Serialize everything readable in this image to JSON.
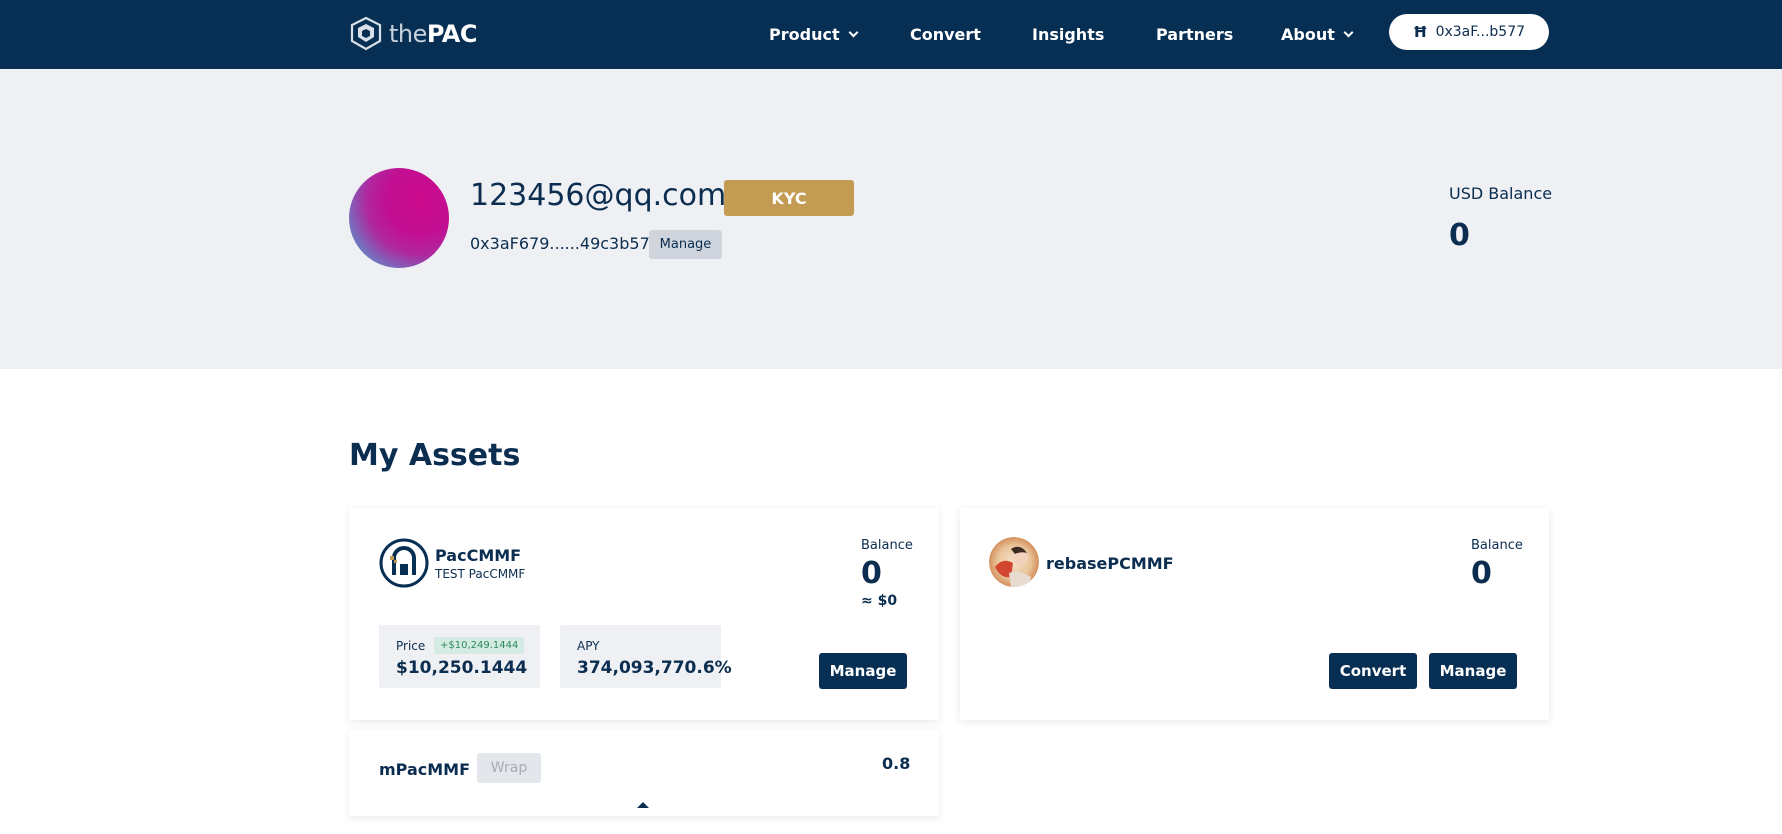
{
  "nav": {
    "logo_the": "the",
    "logo_pac": "PAC",
    "items": [
      {
        "label": "Product",
        "has_dropdown": true
      },
      {
        "label": "Convert",
        "has_dropdown": false
      },
      {
        "label": "Insights",
        "has_dropdown": false
      },
      {
        "label": "Partners",
        "has_dropdown": false
      },
      {
        "label": "About",
        "has_dropdown": true
      }
    ],
    "wallet_label": "0x3aF...b577",
    "wallet_icon": "wallet-h-icon"
  },
  "profile": {
    "email": "123456@qq.com",
    "kyc_label": "KYC",
    "address": "0x3aF679......49c3b577",
    "manage_label": "Manage",
    "usd_balance_label": "USD Balance",
    "usd_balance_value": "0"
  },
  "assets": {
    "title": "My Assets",
    "pac": {
      "name": "PacCMMF",
      "subtitle": "TEST PacCMMF",
      "balance_label": "Balance",
      "balance_value": "0",
      "balance_usd": "≈ $0",
      "price_label": "Price",
      "price_change": "+$10,249.1444",
      "price_value": "$10,250.1444",
      "apy_label": "APY",
      "apy_value": "374,093,770.6%",
      "manage_label": "Manage"
    },
    "rebase": {
      "name": "rebasePCMMF",
      "balance_label": "Balance",
      "balance_value": "0",
      "convert_label": "Convert",
      "manage_label": "Manage"
    },
    "mpac": {
      "name": "mPacMMF",
      "wrap_label": "Wrap",
      "value": "0.8"
    }
  },
  "colors": {
    "navy": "#072f53",
    "gold": "#c49b53",
    "band": "#eff0f4",
    "positive": "#2d8a5e"
  }
}
